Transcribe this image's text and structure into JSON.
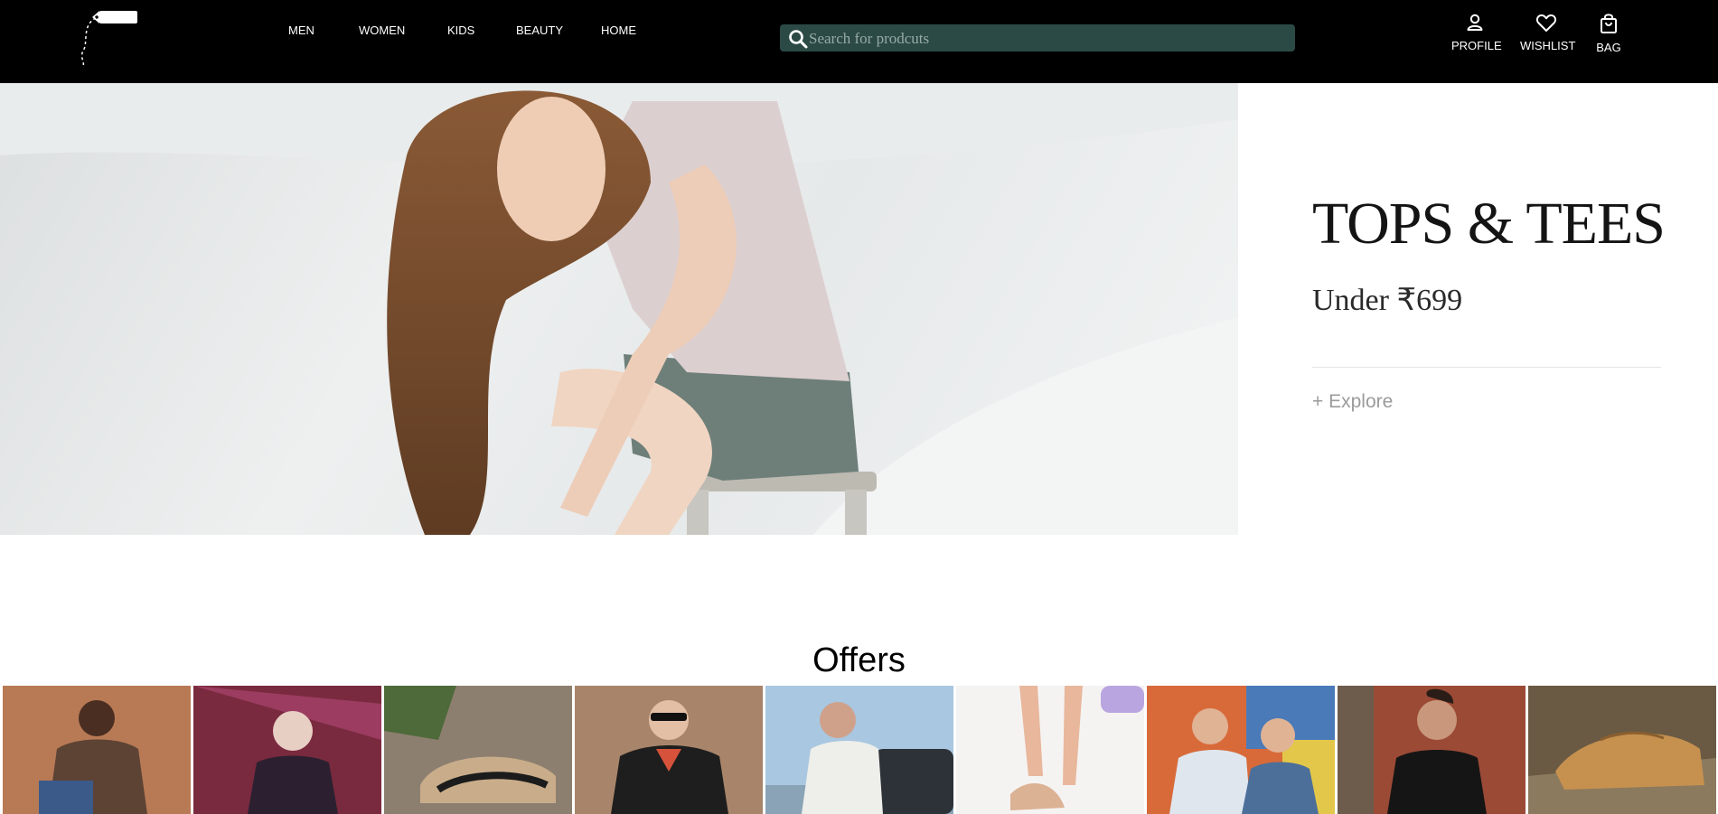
{
  "header": {
    "nav": [
      {
        "label": "MEN"
      },
      {
        "label": "WOMEN"
      },
      {
        "label": "KIDS"
      },
      {
        "label": "BEAUTY"
      },
      {
        "label": "HOME"
      }
    ],
    "search": {
      "placeholder": "Search for prodcuts",
      "bg_color": "#2c4a45"
    },
    "actions": [
      {
        "label": "PROFILE",
        "icon": "person-icon"
      },
      {
        "label": "WISHLIST",
        "icon": "heart-icon"
      },
      {
        "label": "BAG",
        "icon": "bag-icon"
      }
    ]
  },
  "hero": {
    "title": "TOPS & TEES",
    "subtitle": "Under ₹699",
    "cta": "+ Explore"
  },
  "offers": {
    "title": "Offers",
    "tiles": [
      {
        "icon": "man-sitting-brown-outfit-photo"
      },
      {
        "icon": "man-patterned-shirt-neon-photo"
      },
      {
        "icon": "sneaker-closeup-photo"
      },
      {
        "icon": "man-sunglasses-jacket-photo"
      },
      {
        "icon": "man-striped-shirt-car-photo"
      },
      {
        "icon": "heels-legs-photo"
      },
      {
        "icon": "two-men-polo-shirts-photo"
      },
      {
        "icon": "man-black-tshirt-photo"
      },
      {
        "icon": "tan-shoes-photo"
      }
    ]
  }
}
